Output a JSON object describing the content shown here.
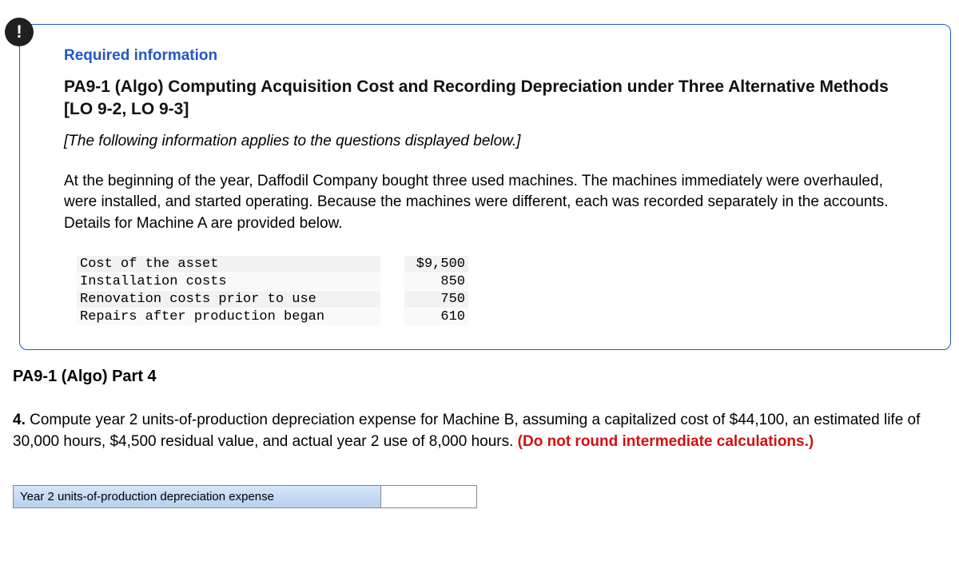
{
  "badge": "!",
  "required_heading": "Required information",
  "main_title": "PA9-1 (Algo) Computing Acquisition Cost and Recording Depreciation under Three Alternative Methods [LO 9-2, LO 9-3]",
  "italic_note": "[The following information applies to the questions displayed below.]",
  "body_text": "At the beginning of the year, Daffodil Company bought three used machines. The machines immediately were overhauled, were installed, and started operating. Because the machines were different, each was recorded separately in the accounts. Details for Machine A are provided below.",
  "cost_rows": [
    {
      "label": "Cost of the asset",
      "value": "$9,500"
    },
    {
      "label": "Installation costs",
      "value": "850"
    },
    {
      "label": "Renovation costs prior to use",
      "value": "750"
    },
    {
      "label": "Repairs after production began",
      "value": "610"
    }
  ],
  "part_heading": "PA9-1 (Algo) Part 4",
  "question": {
    "num": "4.",
    "text": " Compute year 2 units-of-production depreciation expense for Machine B, assuming a capitalized cost of $44,100, an estimated life of 30,000 hours, $4,500 residual value, and actual year 2 use of 8,000 hours. ",
    "warn": "(Do not round intermediate calculations.)"
  },
  "answer_label": "Year 2 units-of-production depreciation expense",
  "answer_value": ""
}
